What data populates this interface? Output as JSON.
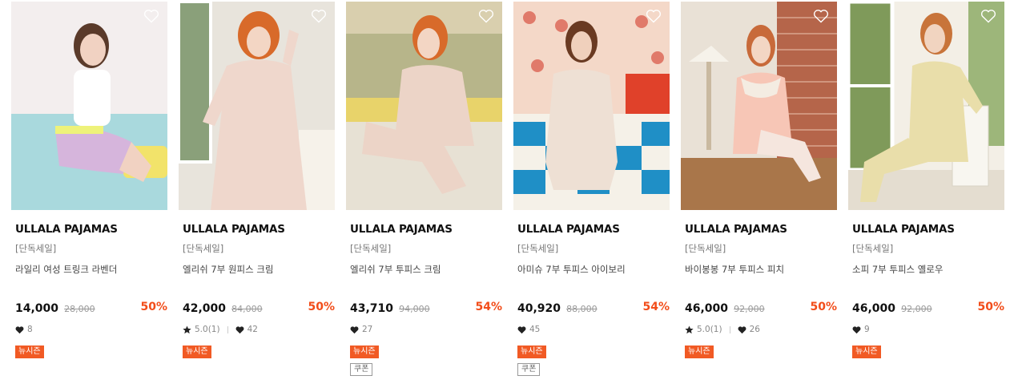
{
  "products": [
    {
      "brand": "ULLALA PAJAMAS",
      "tag": "[단독세일]",
      "name": "라일리 여성 트링크 라벤더",
      "price": "14,000",
      "original_price": "28,000",
      "discount": "50%",
      "rating": "",
      "likes": "8",
      "badges": [
        "뉴시즌"
      ],
      "coupon": "",
      "photo_icon": "woman-lavender-shorts-photo"
    },
    {
      "brand": "ULLALA PAJAMAS",
      "tag": "[단독세일]",
      "name": "엘리쉬 7부 원피스 크림",
      "price": "42,000",
      "original_price": "84,000",
      "discount": "50%",
      "rating": "5.0(1)",
      "likes": "42",
      "badges": [
        "뉴시즌"
      ],
      "coupon": "",
      "photo_icon": "woman-floral-dress-photo"
    },
    {
      "brand": "ULLALA PAJAMAS",
      "tag": "[단독세일]",
      "name": "엘리쉬 7부 투피스 크림",
      "price": "43,710",
      "original_price": "94,000",
      "discount": "54%",
      "rating": "",
      "likes": "27",
      "badges": [
        "뉴시즌"
      ],
      "coupon": "쿠폰",
      "photo_icon": "woman-floral-twopiece-photo"
    },
    {
      "brand": "ULLALA PAJAMAS",
      "tag": "[단독세일]",
      "name": "아미슈 7부 투피스 아이보리",
      "price": "40,920",
      "original_price": "88,000",
      "discount": "54%",
      "rating": "",
      "likes": "45",
      "badges": [
        "뉴시즌"
      ],
      "coupon": "쿠폰",
      "photo_icon": "woman-ivory-twopiece-photo"
    },
    {
      "brand": "ULLALA PAJAMAS",
      "tag": "[단독세일]",
      "name": "바이봉봉 7부 투피스 피치",
      "price": "46,000",
      "original_price": "92,000",
      "discount": "50%",
      "rating": "5.0(1)",
      "likes": "26",
      "badges": [
        "뉴시즌"
      ],
      "coupon": "",
      "photo_icon": "woman-peach-twopiece-photo"
    },
    {
      "brand": "ULLALA PAJAMAS",
      "tag": "[단독세일]",
      "name": "소피 7부 투피스 옐로우",
      "price": "46,000",
      "original_price": "92,000",
      "discount": "50%",
      "rating": "",
      "likes": "9",
      "badges": [
        "뉴시즌"
      ],
      "coupon": "",
      "photo_icon": "woman-yellow-twopiece-photo"
    }
  ],
  "colors": {
    "accent": "#f24d1a",
    "badge": "#f15a24",
    "text": "#111111",
    "muted": "#888888"
  }
}
